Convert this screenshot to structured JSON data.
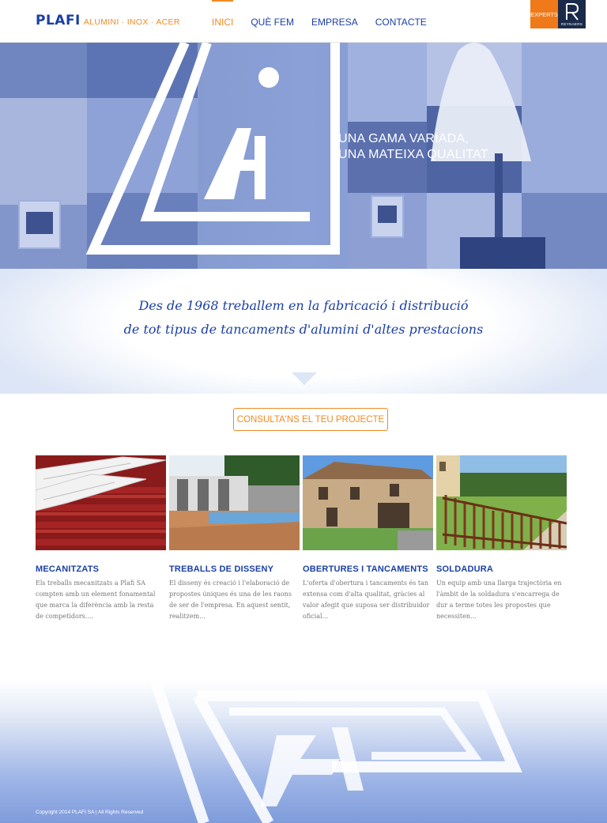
{
  "header": {
    "logo_word": "PLAFI",
    "logo_tagline": "ALUMINI · INOX · ACER",
    "nav": [
      {
        "label": "INICI",
        "active": true
      },
      {
        "label": "QUÈ FEM",
        "active": false
      },
      {
        "label": "EMPRESA",
        "active": false
      },
      {
        "label": "CONTACTE",
        "active": false
      }
    ],
    "badge": {
      "label": "EXPERTS",
      "brand": "REYNAERS"
    }
  },
  "hero": {
    "line1": "UNA GAMA VARIADA,",
    "line2": "UNA MATEIXA QUALITAT"
  },
  "intro": {
    "line1": "Des de 1968 treballem en la fabricació i distribució",
    "line2": "de tot tipus de tancaments d'alumini d'altes prestacions"
  },
  "cta": {
    "label": "CONSULTA'NS EL TEU PROJECTE"
  },
  "services": [
    {
      "title": "MECANITZATS",
      "text": "Els treballs mecanitzats a Plafi SA compten amb un element fonamental que marca la diferència amb la resta de competidors...."
    },
    {
      "title": "TREBALLS DE DISSENY",
      "text": "El disseny és creació i l'elaboració de propostes úniques és una de les raons de ser de l'empresa. En aquest sentit, realitzem..."
    },
    {
      "title": "OBERTURES I TANCAMENTS",
      "text": "L'oferta d'obertura i tancaments és tan extensa com d'alta qualitat, gràcies al valor afegit que suposa ser distribuidor oficial..."
    },
    {
      "title": "SOLDADURA",
      "text": "Un equip amb una llarga trajectòria en l'àmbit de la soldadura s'encarrega de dur a terme totes les propostes que necessiten..."
    }
  ],
  "footer": {
    "copyright": "Copyright 2014 PLAFI SA | All Rights Reserved"
  },
  "colors": {
    "brand_blue": "#1a3fa6",
    "accent_orange": "#f08a24"
  }
}
